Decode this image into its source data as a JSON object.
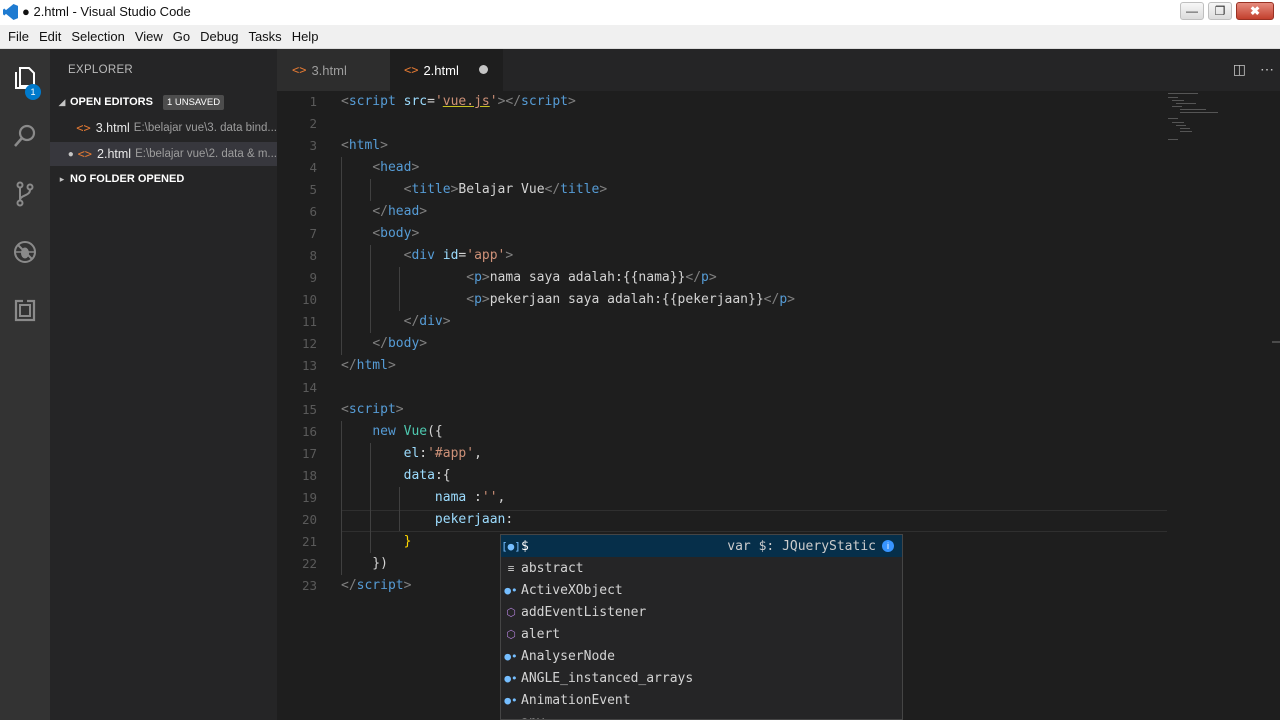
{
  "window": {
    "title": "● 2.html - Visual Studio Code",
    "buttons": [
      "—",
      "❐",
      "✖"
    ]
  },
  "menu": [
    "File",
    "Edit",
    "Selection",
    "View",
    "Go",
    "Debug",
    "Tasks",
    "Help"
  ],
  "activity": {
    "explorer_badge": "1"
  },
  "sidebar": {
    "title": "EXPLORER",
    "open_editors": {
      "label": "OPEN EDITORS",
      "badge": "1 UNSAVED"
    },
    "files": [
      {
        "name": "3.html",
        "path": "E:\\belajar vue\\3. data bind...",
        "dirty": false
      },
      {
        "name": "2.html",
        "path": "E:\\belajar vue\\2. data & m...",
        "dirty": true
      }
    ],
    "no_folder": "NO FOLDER OPENED"
  },
  "tabs": [
    {
      "name": "3.html",
      "active": false
    },
    {
      "name": "2.html",
      "active": true,
      "dirty": true
    }
  ],
  "editor": {
    "line_numbers": [
      "1",
      "2",
      "3",
      "4",
      "5",
      "6",
      "7",
      "8",
      "9",
      "10",
      "11",
      "12",
      "13",
      "14",
      "15",
      "16",
      "17",
      "18",
      "19",
      "20",
      "21",
      "22",
      "23"
    ]
  },
  "suggest": {
    "items": [
      {
        "label": "$",
        "kind": "variable",
        "detail": "var $: JQueryStatic",
        "selected": true
      },
      {
        "label": "abstract",
        "kind": "keyword"
      },
      {
        "label": "ActiveXObject",
        "kind": "variable"
      },
      {
        "label": "addEventListener",
        "kind": "function"
      },
      {
        "label": "alert",
        "kind": "function"
      },
      {
        "label": "AnalyserNode",
        "kind": "variable"
      },
      {
        "label": "ANGLE_instanced_arrays",
        "kind": "variable"
      },
      {
        "label": "AnimationEvent",
        "kind": "variable"
      },
      {
        "label": "any",
        "kind": "keyword"
      }
    ]
  },
  "colors": {
    "accent": "#007acc",
    "editor_bg": "#1e1e1e",
    "sidebar_bg": "#252526",
    "activity_bg": "#333333"
  }
}
